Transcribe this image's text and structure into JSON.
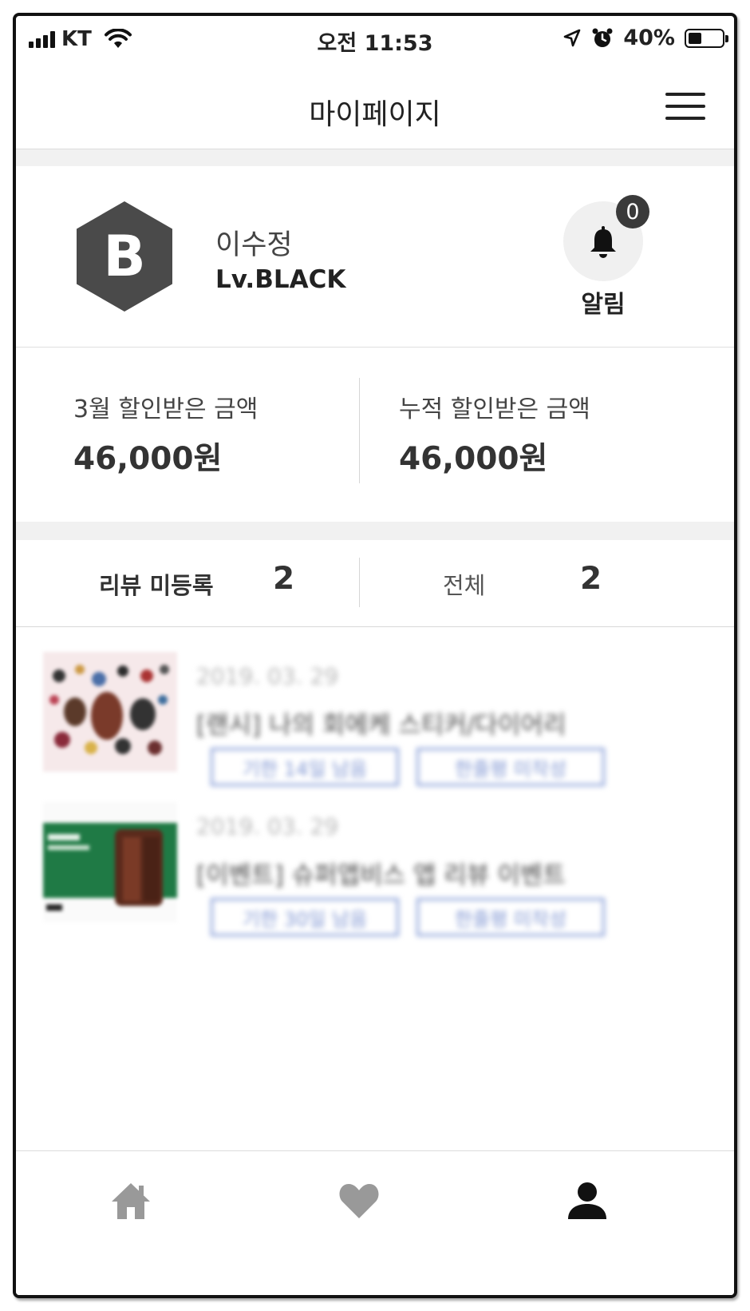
{
  "status_bar": {
    "carrier": "KT",
    "time": "오전 11:53",
    "battery_percent": "40%",
    "battery_level": 0.4
  },
  "header": {
    "title": "마이페이지",
    "menu_icon": "hamburger-icon"
  },
  "profile": {
    "badge_letter": "B",
    "badge_color": "#4a4a4a",
    "name": "이수정",
    "level": "Lv.BLACK",
    "notification_count": "0",
    "notification_label": "알림"
  },
  "discounts": [
    {
      "label": "3월 할인받은 금액",
      "amount": "46,000원"
    },
    {
      "label": "누적 할인받은 금액",
      "amount": "46,000원"
    }
  ],
  "review_tabs": [
    {
      "label": "리뷰 미등록",
      "count": "2",
      "active": true
    },
    {
      "label": "전체",
      "count": "2",
      "active": false
    }
  ],
  "reviews": [
    {
      "date": "2019. 03. 29",
      "title": "[랜시] 나의 회에케 스티커/다이어리",
      "tags": [
        "기한 14일 남음",
        "한줄평 미작성"
      ]
    },
    {
      "date": "2019. 03. 29",
      "title": "[이벤트] 슈퍼앱비스 앱 리뷰 이벤트",
      "tags": [
        "기한 30일 남음",
        "한줄평 미작성"
      ]
    }
  ],
  "bottom_nav": [
    {
      "icon": "home-icon",
      "active": false
    },
    {
      "icon": "heart-icon",
      "active": false
    },
    {
      "icon": "person-icon",
      "active": true
    }
  ],
  "colors": {
    "accent_tag": "#7f95d2",
    "divider": "#dcdcdc",
    "inactive_icon": "#999999",
    "active_icon": "#111111"
  }
}
